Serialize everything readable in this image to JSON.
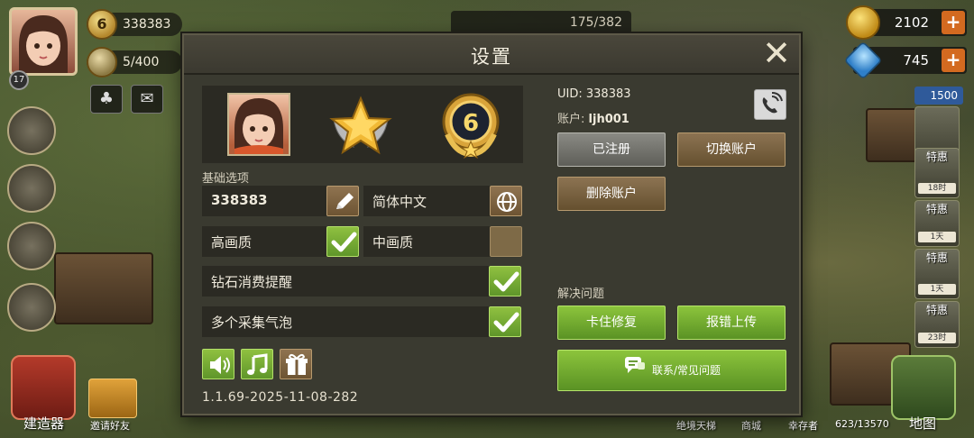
{
  "hud": {
    "player_id": "338383",
    "player_level": "6",
    "energy": "5/400",
    "small_level": "17",
    "storage": "175/382",
    "gold": "2102",
    "diamonds": "745",
    "shop_price": "1500",
    "shop_labels": [
      "1天",
      "特惠",
      "18时",
      "特惠",
      "1天",
      "特惠",
      "1天",
      "特惠",
      "23时"
    ],
    "bottom_left": "建造器",
    "invite": "邀请好友",
    "bottom_labels": [
      "绝境天梯",
      "商城",
      "幸存者",
      "623/13570"
    ],
    "map": "地图"
  },
  "dialog": {
    "title": "设置",
    "level_badge": "6",
    "basic_options_label": "基础选项",
    "name_value": "338383",
    "language": "简体中文",
    "high_quality": "高画质",
    "medium_quality": "中画质",
    "diamond_reminder": "钻石消费提醒",
    "multi_bubble": "多个采集气泡",
    "version": "1.1.69-2025-11-08-282",
    "uid_label": "UID:",
    "uid_value": "338383",
    "account_label": "账户:",
    "account_value": "ljh001",
    "registered": "已注册",
    "switch_account": "切换账户",
    "delete_account": "删除账户",
    "solve_label": "解决问题",
    "stuck_fix": "卡住修复",
    "report_bug": "报错上传",
    "contact_faq": "联系/常见问题"
  },
  "colors": {
    "accent_green": "#7bb034",
    "brown_button": "#7a6040",
    "dialog_bg": "#3a3a30"
  }
}
